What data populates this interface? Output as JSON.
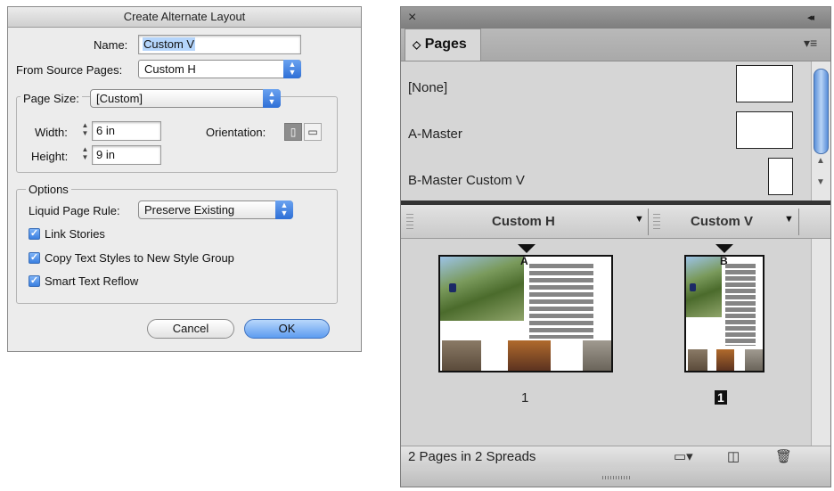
{
  "dialog": {
    "title": "Create Alternate Layout",
    "name_label": "Name:",
    "name_value": "Custom V",
    "source_label": "From Source Pages:",
    "source_value": "Custom H",
    "page_size_label": "Page Size:",
    "page_size_value": "[Custom]",
    "width_label": "Width:",
    "width_value": "6 in",
    "height_label": "Height:",
    "height_value": "9 in",
    "orientation_label": "Orientation:",
    "options_title": "Options",
    "liquid_label": "Liquid Page Rule:",
    "liquid_value": "Preserve Existing",
    "checkboxes": [
      {
        "label": "Link Stories",
        "checked": true
      },
      {
        "label": "Copy Text Styles to New Style Group",
        "checked": true
      },
      {
        "label": "Smart Text Reflow",
        "checked": true
      }
    ],
    "cancel_label": "Cancel",
    "ok_label": "OK"
  },
  "panel": {
    "tab_label": "Pages",
    "masters": [
      {
        "label": "[None]"
      },
      {
        "label": "A-Master"
      },
      {
        "label": "B-Master Custom V"
      }
    ],
    "layouts": [
      {
        "label": "Custom H",
        "master_letter": "A",
        "page_number": "1",
        "selected": false
      },
      {
        "label": "Custom V",
        "master_letter": "B",
        "page_number": "1",
        "selected": true
      }
    ],
    "status_text": "2 Pages in 2 Spreads",
    "close_glyph": "×",
    "collapse_glyph": "◂◂",
    "tab_glyph": "◇"
  },
  "colors": {
    "accent": "#3a7fe0",
    "selection": "#b5d5fb"
  }
}
